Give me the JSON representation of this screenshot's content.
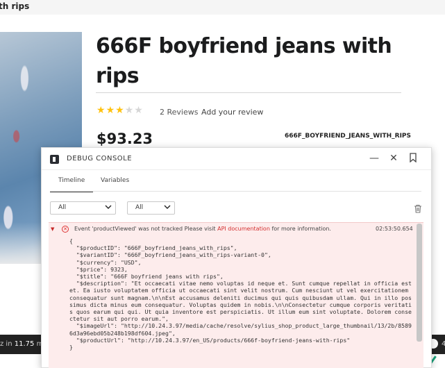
{
  "breadcrumb": {
    "current": "th rips"
  },
  "product": {
    "title": "666F boyfriend jeans with rips",
    "rating": {
      "value": 3,
      "max": 5
    },
    "reviews_label": "2 Reviews",
    "add_review_label": "Add your review",
    "price": "$93.23",
    "sku": "666F_BOYFRIEND_JEANS_WITH_RIPS"
  },
  "toolbar": {
    "time_prefix": "z in",
    "time_value": "11.75",
    "time_unit": "ms",
    "right_count": "4"
  },
  "console": {
    "title": "DEBUG CONSOLE",
    "icons": {
      "minimize": "minimize-icon",
      "close": "close-icon",
      "bookmark": "bookmark-icon",
      "trash": "trash-icon"
    },
    "tabs": [
      {
        "label": "Timeline",
        "active": true
      },
      {
        "label": "Variables",
        "active": false
      }
    ],
    "filters": [
      {
        "value": "All"
      },
      {
        "value": "All"
      }
    ],
    "log": {
      "level": "error",
      "message_before": "Event 'productViewed' was not tracked Please visit ",
      "link_text": "API documentation",
      "message_after": " for more information.",
      "time": "02:53:50.654",
      "json": "{\n  \"$productID\": \"666F_boyfriend_jeans_with_rips\",\n  \"$variantID\": \"666F_boyfriend_jeans_with_rips-variant-0\",\n  \"$currency\": \"USD\",\n  \"$price\": 9323,\n  \"$title\": \"666F boyfriend jeans with rips\",\n  \"$description\": \"Et occaecati vitae nemo voluptas id neque et. Sunt cumque repellat in officia est et. Ea iusto voluptatem officia ut occaecati sint velit nostrum. Cum nesciunt ut vel exercitationem consequatur sunt magnam.\\n\\nEst accusamus deleniti ducimus qui quis quibusdam ullam. Qui in illo possimus dicta minus eum consequatur. Voluptas quidem in nobis.\\n\\nConsectetur cumque corporis veritatis quos earum qui qui. Ut quia inventore est perspiciatis. Ut illum eum sint voluptate. Dolorem consectetur sit aut porro earum.\",\n  \"$imageUrl\": \"http://10.24.3.97/media/cache/resolve/sylius_shop_product_large_thumbnail/13/2b/85896d3a96ebd05b248b198df604.jpeg\",\n  \"$productUrl\": \"http://10.24.3.97/en_US/products/666f-boyfriend-jeans-with-rips\"\n}"
    }
  },
  "colors": {
    "star_on": "#ffc20f",
    "star_off": "#d6d6d6",
    "error_bg": "#fdecec",
    "link": "#d32f2f"
  }
}
